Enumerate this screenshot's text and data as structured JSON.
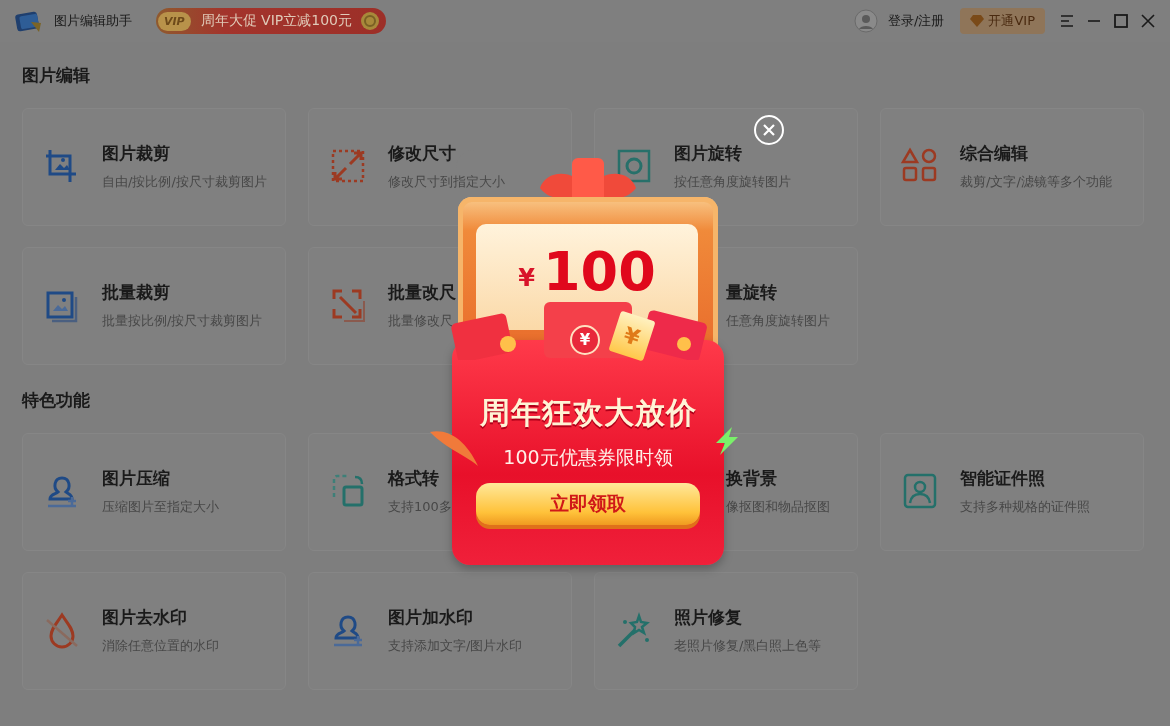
{
  "title_bar": {
    "app_name": "图片编辑助手",
    "promo_banner": "周年大促 VIP立减100元",
    "promo_badge": "VIP",
    "login": "登录/注册",
    "vip_button": "开通VIP"
  },
  "sections": [
    {
      "title": "图片编辑",
      "cards": [
        {
          "title": "图片裁剪",
          "description": "自由/按比例/按尺寸裁剪图片"
        },
        {
          "title": "修改尺寸",
          "description": "修改尺寸到指定大小"
        },
        {
          "title": "图片旋转",
          "description": "按任意角度旋转图片"
        },
        {
          "title": "综合编辑",
          "description": "裁剪/文字/滤镜等多个功能"
        },
        {
          "title": "批量裁剪",
          "description": "批量按比例/按尺寸裁剪图片"
        },
        {
          "title": "批量改尺",
          "description": "批量修改尺"
        },
        {
          "title": "量旋转",
          "description": "任意角度旋转图片"
        }
      ]
    },
    {
      "title": "特色功能",
      "cards": [
        {
          "title": "图片压缩",
          "description": "压缩图片至指定大小"
        },
        {
          "title": "格式转",
          "description": "支持100多"
        },
        {
          "title": "换背景",
          "description": "像抠图和物品抠图"
        },
        {
          "title": "智能证件照",
          "description": "支持多种规格的证件照"
        },
        {
          "title": "图片去水印",
          "description": "消除任意位置的水印"
        },
        {
          "title": "图片加水印",
          "description": "支持添加文字/图片水印"
        },
        {
          "title": "照片修复",
          "description": "老照片修复/黑白照上色等"
        }
      ]
    }
  ],
  "popup": {
    "currency": "¥",
    "amount": "100",
    "coin_symbol": "¥",
    "ticket_symbol": "¥",
    "headline": "周年狂欢大放价",
    "subtitle": "100元优惠券限时领",
    "button": "立即领取"
  }
}
